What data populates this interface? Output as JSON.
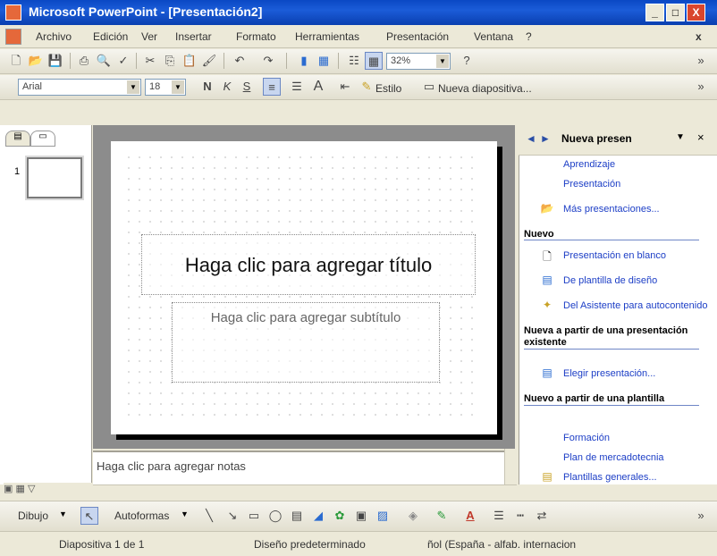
{
  "window": {
    "title": "Microsoft PowerPoint - [Presentación2]",
    "minimize": "_",
    "maximize": "□",
    "close": "X"
  },
  "menu": {
    "items": [
      "Archivo",
      "Edición",
      "Ver",
      "Insertar",
      "Formato",
      "Herramientas",
      "Presentación",
      "Ventana",
      "?"
    ],
    "close_doc": "x"
  },
  "toolbar_standard": {
    "zoom": "32%"
  },
  "toolbar_format": {
    "font": "Arial",
    "size": "18",
    "bold": "N",
    "italic": "K",
    "underline": "S",
    "design": "Estilo",
    "new_slide": "Nueva diapositiva..."
  },
  "outline": {
    "slide_number": "1"
  },
  "slide": {
    "title_placeholder": "Haga clic para agregar título",
    "subtitle_placeholder": "Haga clic para agregar subtítulo"
  },
  "notes": {
    "placeholder": "Haga clic para agregar notas"
  },
  "taskpane": {
    "title": "Nueva presen",
    "links_top": [
      "Aprendizaje",
      "Presentación",
      "Más presentaciones..."
    ],
    "section_new": "Nuevo",
    "new_items": [
      "Presentación en blanco",
      "De plantilla de diseño",
      "Del Asistente para autocontenido"
    ],
    "section_existing": "Nueva a partir de una presentación existente",
    "existing_items": [
      "Elegir presentación..."
    ],
    "section_template": "Nuevo a partir de una plantilla",
    "template_items": [
      "Formación",
      "Plan de mercadotecnia",
      "Plantillas generales..."
    ]
  },
  "drawbar": {
    "draw": "Dibujo",
    "autoshapes": "Autoformas"
  },
  "status": {
    "slide": "Diapositiva 1 de 1",
    "design": "Diseño predeterminado",
    "language": "ñol (España - alfab. internacion"
  }
}
